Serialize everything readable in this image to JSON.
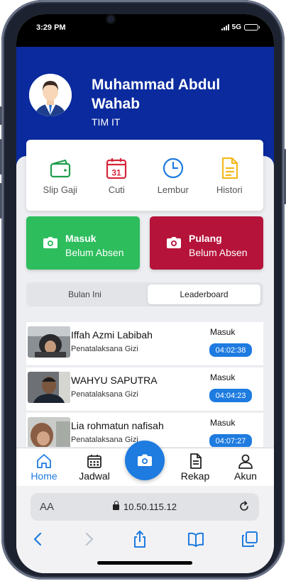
{
  "status_bar": {
    "time": "3:29 PM",
    "network": "5G"
  },
  "profile": {
    "name": "Muhammad Abdul Wahab",
    "team": "TIM IT"
  },
  "menu": [
    {
      "label": "Slip Gaji",
      "icon": "wallet-icon",
      "color": "#1f9d4c"
    },
    {
      "label": "Cuti",
      "icon": "calendar-31-icon",
      "color": "#d6263b",
      "day": "31"
    },
    {
      "label": "Lembur",
      "icon": "clock-icon",
      "color": "#1e7be0"
    },
    {
      "label": "Histori",
      "icon": "document-icon",
      "color": "#f2b81e"
    }
  ],
  "attendance": {
    "in": {
      "title": "Masuk",
      "status": "Belum Absen",
      "color": "#2dbd5d"
    },
    "out": {
      "title": "Pulang",
      "status": "Belum Absen",
      "color": "#b5133a"
    }
  },
  "tabs": [
    {
      "label": "Bulan Ini",
      "active": false
    },
    {
      "label": "Leaderboard",
      "active": true
    }
  ],
  "leaderboard": [
    {
      "name": "Iffah Azmi Labibah",
      "role": "Penatalaksana Gizi",
      "label": "Masuk",
      "time": "04:02:38"
    },
    {
      "name": "WAHYU SAPUTRA",
      "role": "Penatalaksana Gizi",
      "label": "Masuk",
      "time": "04:04:23"
    },
    {
      "name": "Lia rohmatun nafisah",
      "role": "Penatalaksana Gizi",
      "label": "Masuk",
      "time": "04:07:27"
    }
  ],
  "bottom_nav": [
    {
      "label": "Home",
      "icon": "home-icon",
      "active": true
    },
    {
      "label": "Jadwal",
      "icon": "calendar-icon",
      "active": false
    },
    {
      "label": "",
      "icon": "camera-icon",
      "active": false
    },
    {
      "label": "Rekap",
      "icon": "document-icon",
      "active": false
    },
    {
      "label": "Akun",
      "icon": "user-icon",
      "active": false
    }
  ],
  "browser": {
    "text_size_label": "AA",
    "url": "10.50.115.12"
  },
  "colors": {
    "header": "#0a2a9e",
    "accent": "#1e7be0"
  }
}
